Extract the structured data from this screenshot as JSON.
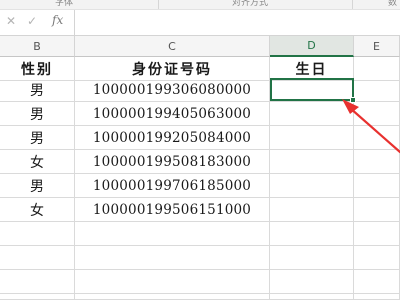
{
  "ribbon": {
    "groups": [
      "字体",
      "对齐方式",
      "数"
    ]
  },
  "formula_bar": {
    "cancel_icon": "close-icon",
    "confirm_icon": "check-icon",
    "fx_label": "fx",
    "value": ""
  },
  "columns": [
    "B",
    "C",
    "D",
    "E"
  ],
  "selected_column": "D",
  "header_row": {
    "gender": "性别",
    "id": "身份证号码",
    "birthday": "生日"
  },
  "rows": [
    {
      "gender": "男",
      "id": "100000199306080000",
      "birthday": ""
    },
    {
      "gender": "男",
      "id": "100000199405063000",
      "birthday": ""
    },
    {
      "gender": "男",
      "id": "100000199205084000",
      "birthday": ""
    },
    {
      "gender": "女",
      "id": "100000199508183000",
      "birthday": ""
    },
    {
      "gender": "男",
      "id": "100000199706185000",
      "birthday": ""
    },
    {
      "gender": "女",
      "id": "100000199506151000",
      "birthday": ""
    }
  ],
  "active_cell": "D2",
  "annotation_color": "#e8312f",
  "accent_color": "#217346"
}
